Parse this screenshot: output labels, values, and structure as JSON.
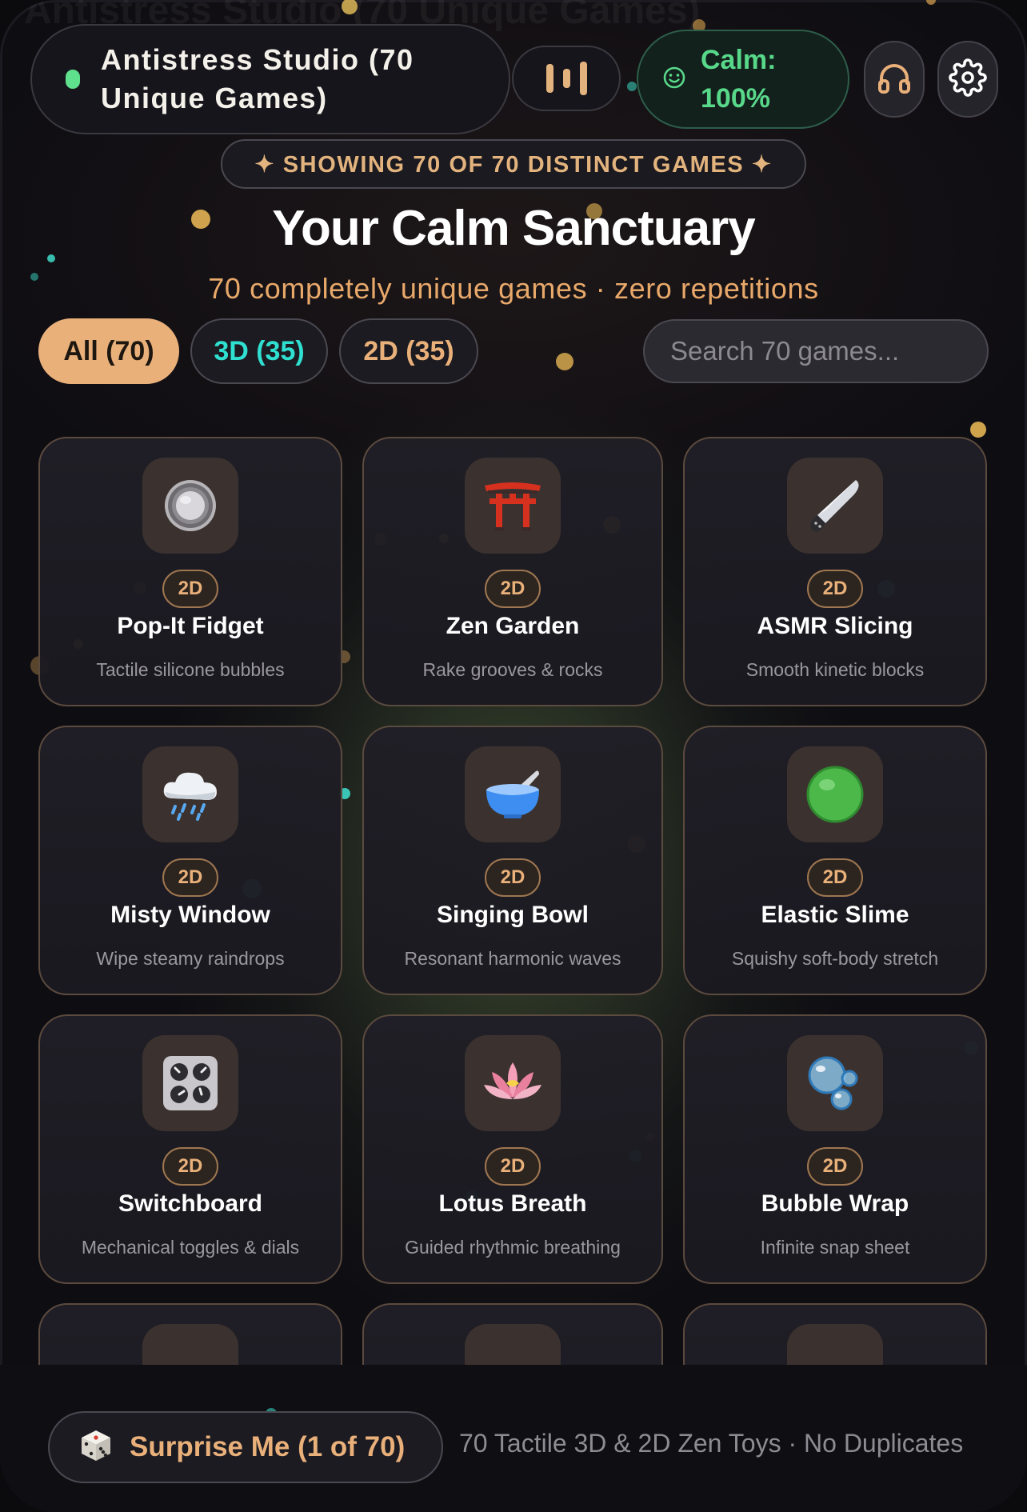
{
  "app": {
    "title": "Antistress Studio (70 Unique Games)",
    "calm_status": "Calm: 100%"
  },
  "banner": {
    "showing_text": "✦ SHOWING 70 OF 70 DISTINCT GAMES ✦"
  },
  "hero": {
    "title": "Your Calm Sanctuary",
    "subtitle": "70 completely unique games · zero repetitions"
  },
  "filters": {
    "tabs": [
      {
        "label": "All (70)",
        "active": true
      },
      {
        "label": "3D (35)",
        "active": false
      },
      {
        "label": "2D (35)",
        "active": false
      }
    ],
    "search_placeholder": "Search 70 games..."
  },
  "games": [
    {
      "title": "Pop-It Fidget",
      "desc": "Tactile silicone bubbles",
      "badge": "2D",
      "icon": "fidget-disc-icon"
    },
    {
      "title": "Zen Garden",
      "desc": "Rake grooves & rocks",
      "badge": "2D",
      "icon": "torii-gate-icon"
    },
    {
      "title": "ASMR Slicing",
      "desc": "Smooth kinetic blocks",
      "badge": "2D",
      "icon": "knife-icon"
    },
    {
      "title": "Misty Window",
      "desc": "Wipe steamy raindrops",
      "badge": "2D",
      "icon": "rain-cloud-icon"
    },
    {
      "title": "Singing Bowl",
      "desc": "Resonant harmonic waves",
      "badge": "2D",
      "icon": "bowl-icon"
    },
    {
      "title": "Elastic Slime",
      "desc": "Squishy soft-body stretch",
      "badge": "2D",
      "icon": "green-slime-icon"
    },
    {
      "title": "Switchboard",
      "desc": "Mechanical toggles & dials",
      "badge": "2D",
      "icon": "control-knobs-icon"
    },
    {
      "title": "Lotus Breath",
      "desc": "Guided rhythmic breathing",
      "badge": "2D",
      "icon": "lotus-icon"
    },
    {
      "title": "Bubble Wrap",
      "desc": "Infinite snap sheet",
      "badge": "2D",
      "icon": "bubbles-icon"
    },
    {
      "title": "",
      "desc": "",
      "badge": "",
      "icon": "blue-item-icon"
    },
    {
      "title": "",
      "desc": "",
      "badge": "",
      "icon": "rock-icon"
    },
    {
      "title": "",
      "desc": "",
      "badge": "",
      "icon": "hourglass-icon"
    }
  ],
  "footer": {
    "surprise_label": "Surprise Me (1 of 70)",
    "tagline": "70 Tactile 3D & 2D Zen Toys · No Duplicates"
  },
  "colors": {
    "accent": "#e9b07a",
    "calm_green": "#58d98a",
    "teal": "#2fe0d0",
    "card_border": "#5b4a3e"
  }
}
